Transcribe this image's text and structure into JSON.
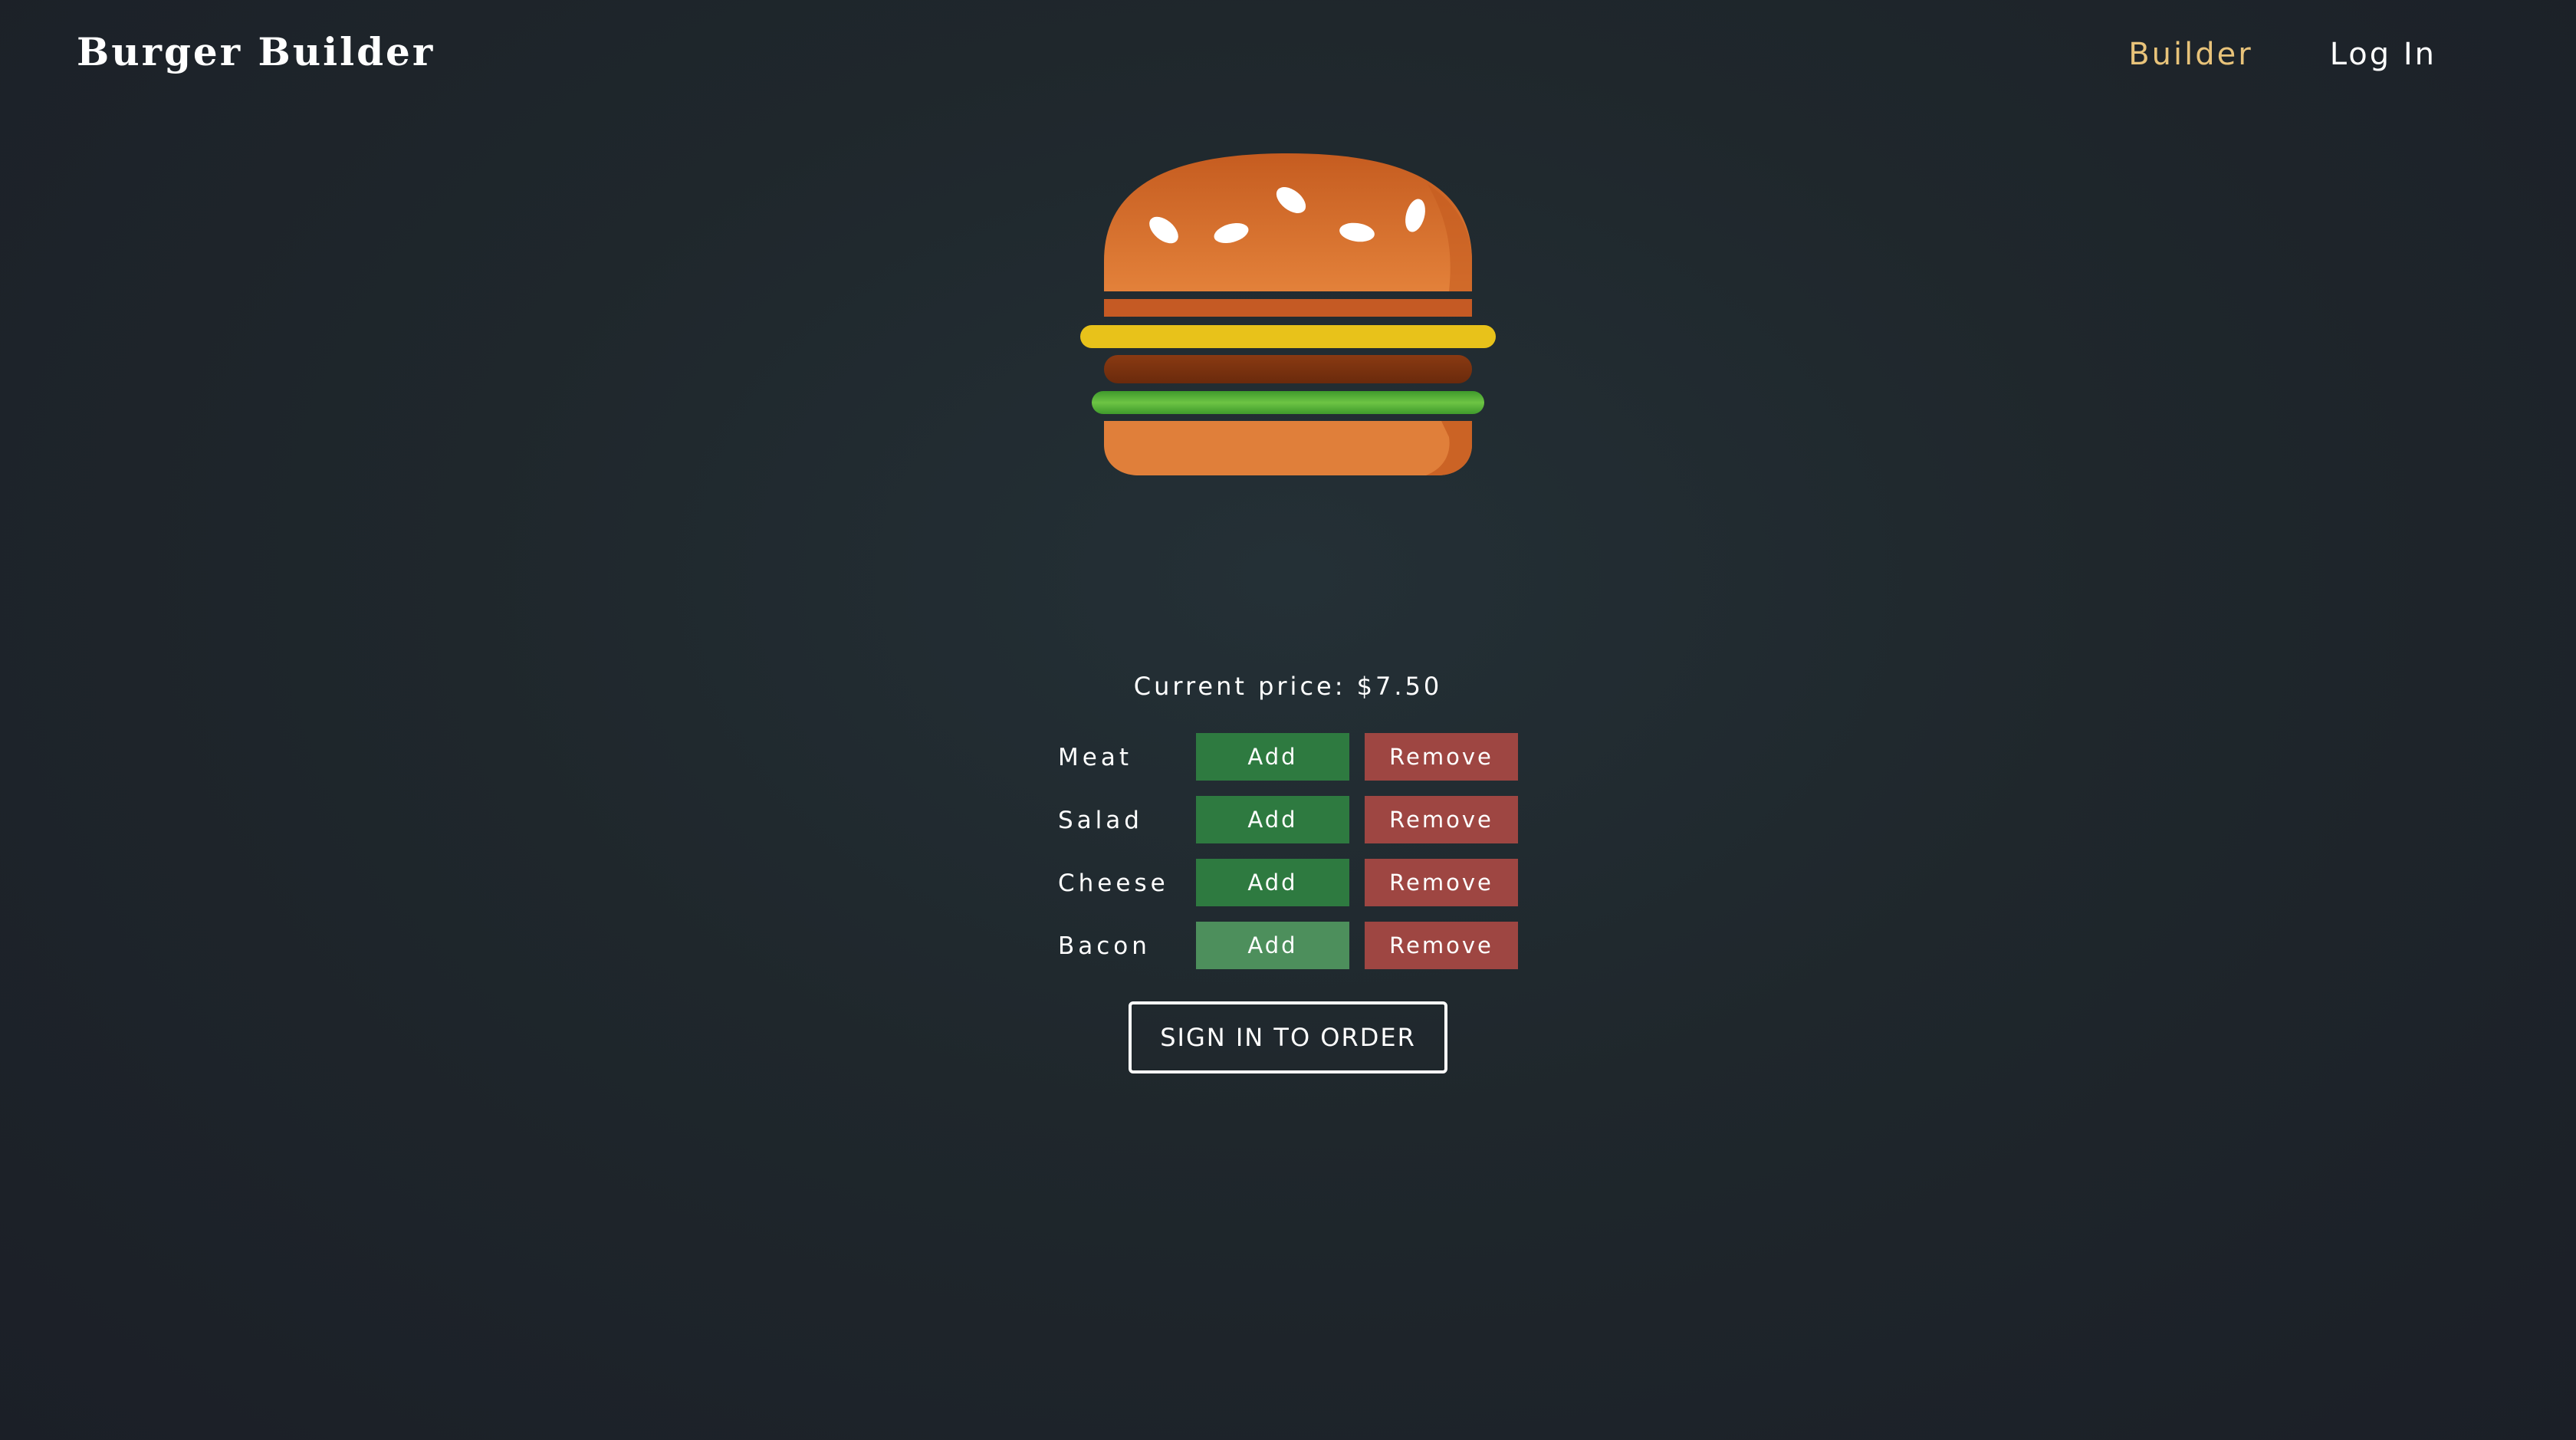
{
  "header": {
    "logo": "Burger Builder",
    "nav": [
      {
        "label": "Builder",
        "active": true
      },
      {
        "label": "Log In",
        "active": false
      }
    ]
  },
  "price": {
    "label": "Current price: $7.50"
  },
  "controls": [
    {
      "label": "Meat",
      "add": "Add",
      "remove": "Remove"
    },
    {
      "label": "Salad",
      "add": "Add",
      "remove": "Remove"
    },
    {
      "label": "Cheese",
      "add": "Add",
      "remove": "Remove"
    },
    {
      "label": "Bacon",
      "add": "Add",
      "remove": "Remove"
    }
  ],
  "order_button": "SIGN IN TO ORDER",
  "colors": {
    "accent": "#e8c37a",
    "add": "#2e7a40",
    "remove": "#9e4642",
    "bun": "#e07f3a",
    "cheese": "#e8c21a",
    "meat": "#7a3010",
    "salad": "#5fb63c"
  }
}
